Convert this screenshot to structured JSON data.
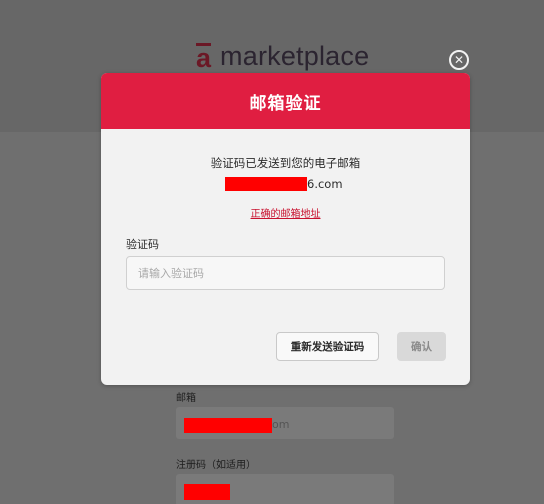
{
  "brand": {
    "mark": "a",
    "name": "marketplace",
    "mark_color": "#6b1826"
  },
  "close": {
    "icon": "close-circle-icon",
    "glyph": "✕"
  },
  "modal": {
    "title": "邮箱验证",
    "header_color": "#e01e41",
    "sent_message": "验证码已发送到您的电子邮箱",
    "email_suffix": "6.com",
    "correct_email_link": "正确的邮箱地址",
    "code_label": "验证码",
    "code_placeholder": "请输入验证码",
    "resend_button": "重新发送验证码",
    "confirm_button": "确认"
  },
  "background_form": {
    "email_label": "邮箱",
    "email_value_suffix": "om",
    "signup_code_label": "注册码（如适用）"
  },
  "redaction_color": "#ff0000"
}
